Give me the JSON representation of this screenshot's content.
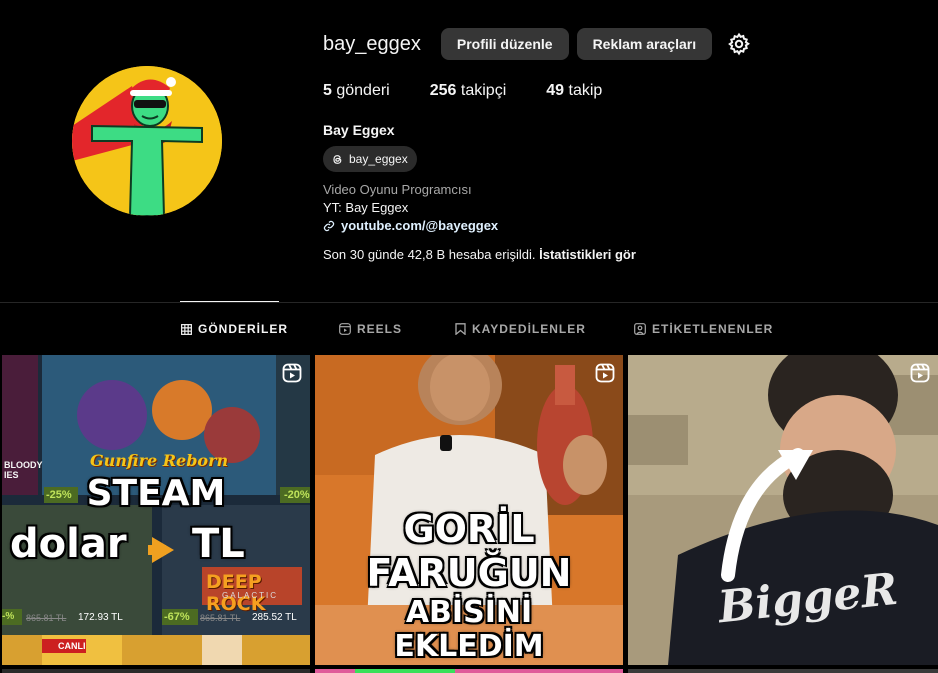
{
  "profile": {
    "username": "bay_eggex",
    "edit_label": "Profili düzenle",
    "ads_label": "Reklam araçları",
    "posts_count": "5",
    "posts_label": "gönderi",
    "followers_count": "256",
    "followers_label": "takipçi",
    "following_count": "49",
    "following_label": "takip",
    "full_name": "Bay Eggex",
    "threads_handle": "bay_eggex",
    "category": "Video Oyunu Programcısı",
    "bio_line": "YT: Bay Eggex",
    "link": "youtube.com/@bayeggex",
    "reach_text": "Son 30 günde 42,8 B hesaba erişildi.",
    "reach_link": "İstatistikleri gör"
  },
  "tabs": [
    {
      "label": "GÖNDERİLER",
      "icon": "grid-icon",
      "active": true
    },
    {
      "label": "REELS",
      "icon": "reels-icon",
      "active": false
    },
    {
      "label": "KAYDEDİLENLER",
      "icon": "bookmark-icon",
      "active": false
    },
    {
      "label": "ETİKETLENENLER",
      "icon": "tag-icon",
      "active": false
    }
  ],
  "posts": [
    {
      "type": "reel",
      "caption_line1": "STEAM",
      "caption_line2": "dolar",
      "caption_line3": "TL",
      "game_title": "Gunfire Reborn",
      "game_title_2": "DEEP ROCK",
      "game_title_2_sub": "GALACTIC",
      "discount_1": "-25%",
      "discount_2": "-20%",
      "discount_3": "-67%",
      "discount_4": "-%",
      "price_old_1": "865.81 TL",
      "price_new_1": "172.93 TL",
      "price_old_2": "865.81 TL",
      "price_new_2": "285.52 TL",
      "side_text": "BLOODY\nIES",
      "live_label": "CANLI"
    },
    {
      "type": "reel",
      "caption_line1": "GORİL",
      "caption_line2": "FARUĞUN",
      "caption_line3": "ABİSİNİ",
      "caption_line4": "EKLEDİM"
    },
    {
      "type": "reel",
      "shirt_text": "BiggeR"
    }
  ],
  "colors": {
    "background": "#000000",
    "button": "#363636",
    "muted": "#a8a8a8",
    "link": "#e0f1ff",
    "avatar_bg": "#f5c518"
  }
}
